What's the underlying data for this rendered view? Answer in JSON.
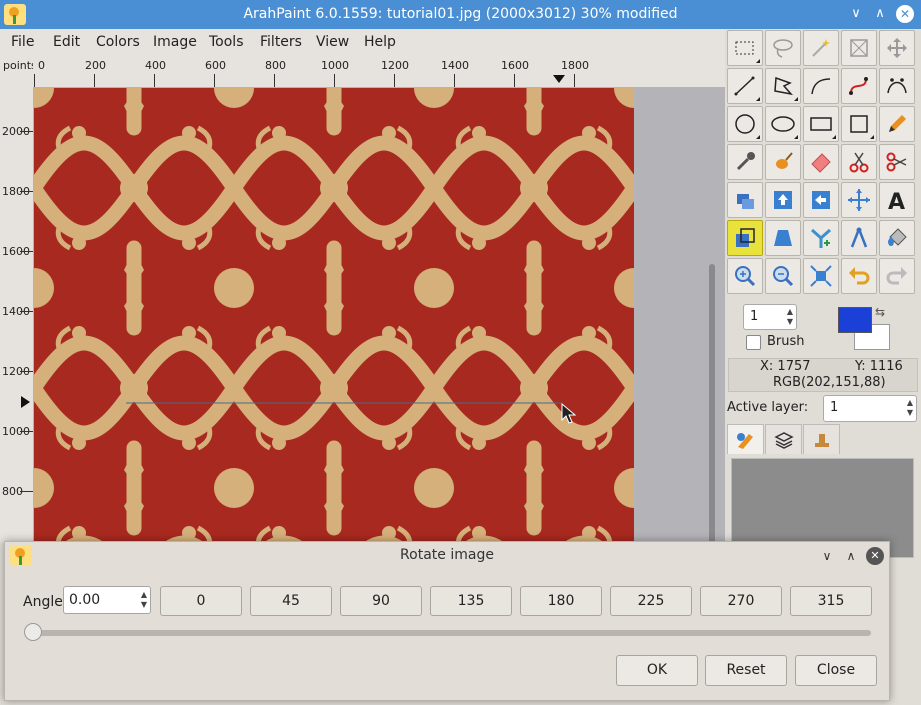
{
  "window": {
    "title": "ArahPaint 6.0.1559: tutorial01.jpg (2000x3012) 30% modified",
    "minimize": "∨",
    "maximize": "∧",
    "close": "✕"
  },
  "menu": [
    "File",
    "Edit",
    "Colors",
    "Image",
    "Tools",
    "Filters",
    "View",
    "Help"
  ],
  "ruler": {
    "unit": "points",
    "top_ticks": [
      "0",
      "200",
      "400",
      "600",
      "800",
      "1000",
      "1200",
      "1400",
      "1600",
      "1800"
    ],
    "left_ticks": [
      "2000",
      "1800",
      "1600",
      "1400",
      "1200",
      "1000",
      "800"
    ]
  },
  "tools": {
    "rows": [
      [
        "rect-select",
        "lasso",
        "magic-wand",
        "crop",
        "move"
      ],
      [
        "line",
        "polygon",
        "curve",
        "bezier-red",
        "bezier"
      ],
      [
        "ellipse-select",
        "ellipse",
        "rectangle",
        "square",
        "pencil"
      ],
      [
        "eyedropper",
        "brush",
        "eraser",
        "scissors",
        "scissors-alt"
      ],
      [
        "clone",
        "flip-vertical",
        "flip-horizontal",
        "move-center",
        "text"
      ],
      [
        "rotate",
        "perspective",
        "fork",
        "compass",
        "bucket"
      ],
      [
        "zoom-in",
        "zoom-out",
        "fit",
        "undo",
        "redo"
      ]
    ],
    "active": "rotate"
  },
  "brush": {
    "size": "1",
    "label": "Brush",
    "checked": false
  },
  "colors": {
    "foreground": "#1a40d8",
    "background": "#ffffff"
  },
  "status": {
    "x": "X: 1757",
    "y": "Y: 1116",
    "rgb": "RGB(202,151,88)"
  },
  "layer": {
    "label": "Active layer:",
    "value": "1"
  },
  "dialog": {
    "title": "Rotate image",
    "angle_label": "Angle",
    "angle_value": "0.00",
    "presets": [
      "0",
      "45",
      "90",
      "135",
      "180",
      "225",
      "270",
      "315"
    ],
    "slider_value": 0,
    "ok": "OK",
    "reset": "Reset",
    "close": "Close"
  }
}
